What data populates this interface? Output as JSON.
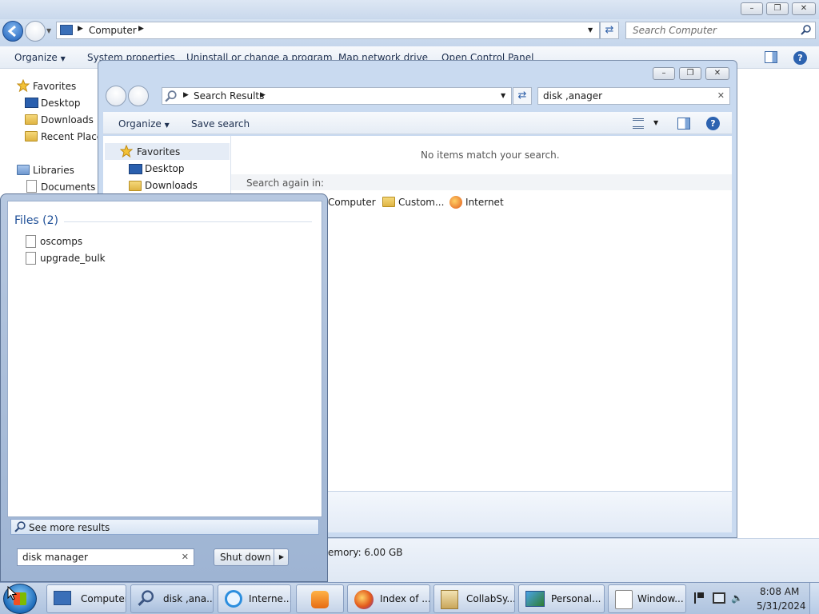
{
  "back_window": {
    "address_segments": [
      "Computer"
    ],
    "search_placeholder": "Search Computer",
    "commands": [
      "Organize",
      "System properties",
      "Uninstall or change a program",
      "Map network drive",
      "Open Control Panel"
    ],
    "nav": {
      "favorites_label": "Favorites",
      "favorites": [
        "Desktop",
        "Downloads",
        "Recent Places"
      ],
      "libraries_label": "Libraries",
      "libraries": [
        "Documents"
      ]
    },
    "details_text": "emory: 6.00 GB"
  },
  "search_window": {
    "address_segments": [
      "Search Results"
    ],
    "search_value": "disk ,anager",
    "commands": [
      "Organize",
      "Save search"
    ],
    "nav": {
      "favorites_label": "Favorites",
      "favorites": [
        "Desktop",
        "Downloads"
      ]
    },
    "no_items_message": "No items match your search.",
    "search_again_label": "Search again in:",
    "search_again_targets": [
      "Computer",
      "Custom...",
      "Internet"
    ]
  },
  "start_menu": {
    "group_header": "Files (2)",
    "files": [
      "oscomps",
      "upgrade_bulk"
    ],
    "see_more": "See more results",
    "search_value": "disk manager",
    "shutdown_label": "Shut down"
  },
  "taskbar": {
    "buttons": [
      "Computer",
      "disk ,ana...",
      "Interne...",
      "",
      "Index of ...",
      "CollabSy...",
      "Personal...",
      "Window..."
    ],
    "clock_time": "8:08 AM",
    "clock_date": "5/31/2024"
  }
}
